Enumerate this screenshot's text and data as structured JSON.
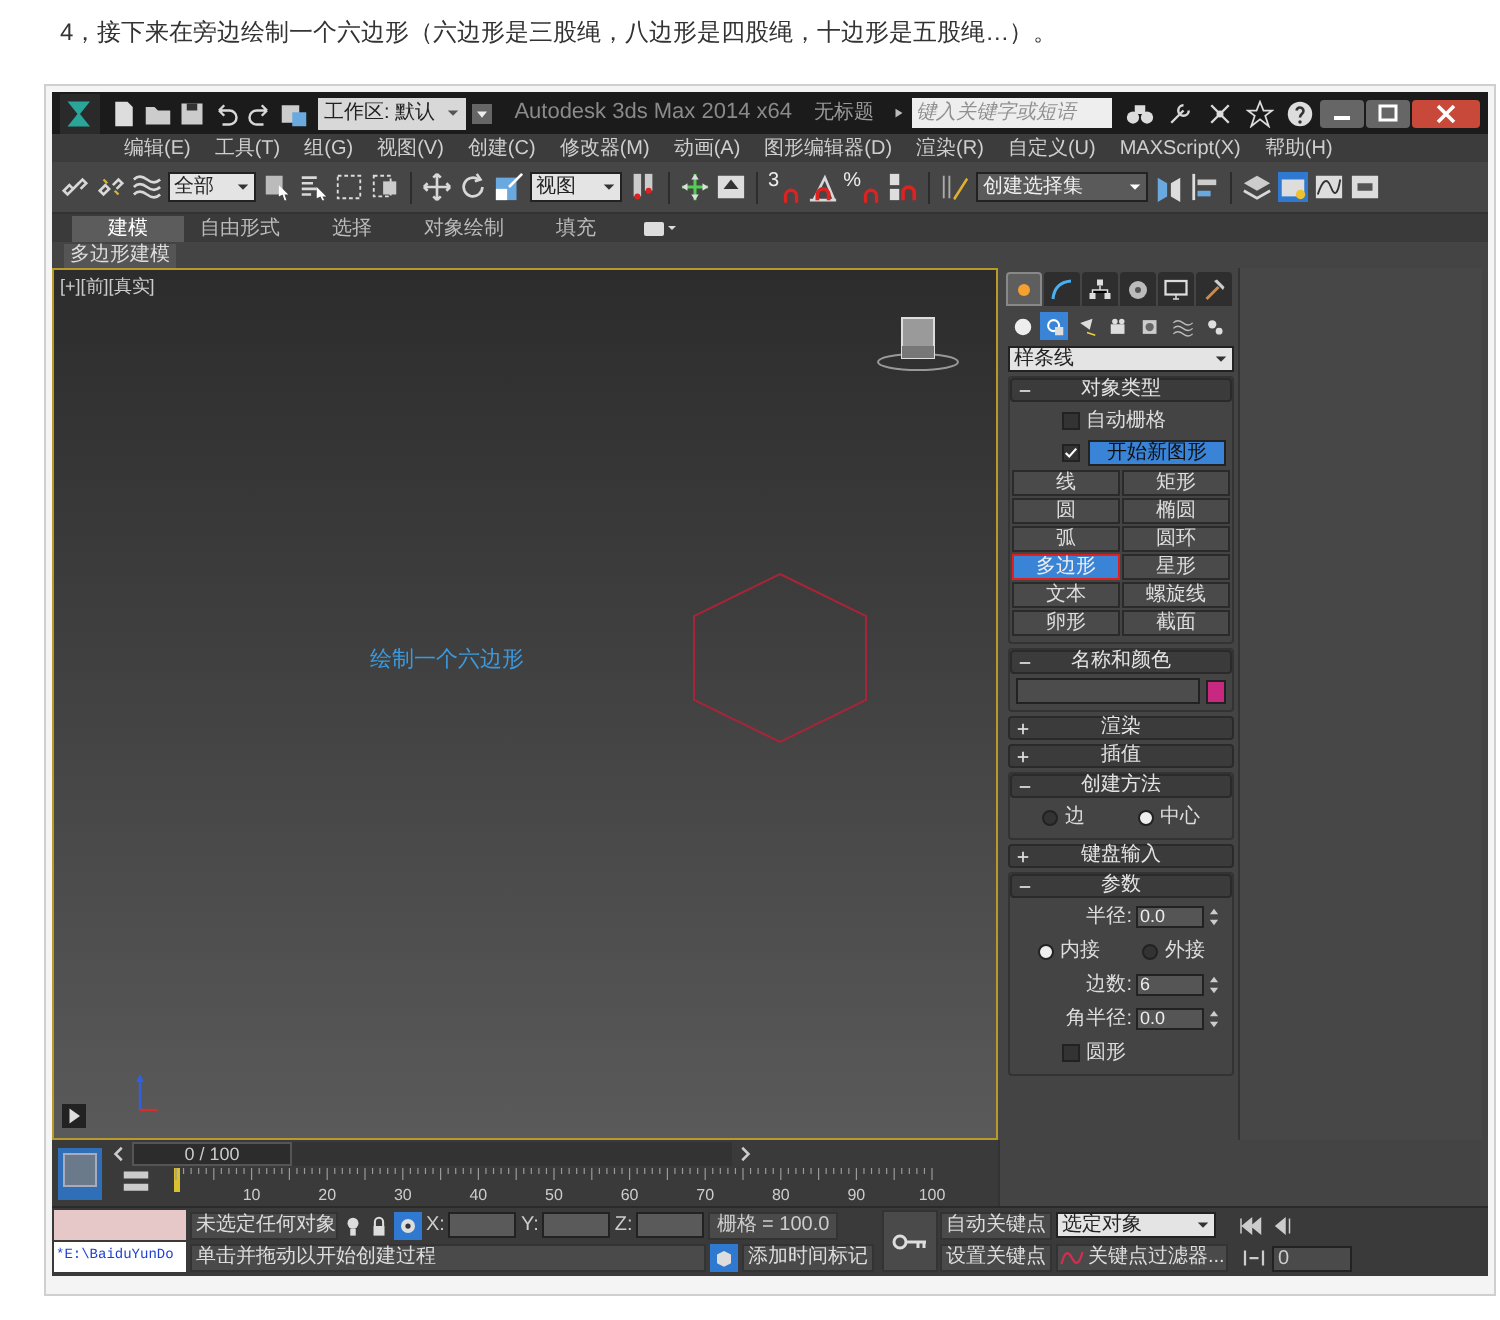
{
  "caption": "4，接下来在旁边绘制一个六边形（六边形是三股绳，八边形是四股绳，十边形是五股绳…）。",
  "title_bar": {
    "workspace": "工作区: 默认",
    "title": "Autodesk 3ds Max 2014 x64",
    "document": "无标题",
    "search_placeholder": "键入关键字或短语"
  },
  "menu": [
    "编辑(E)",
    "工具(T)",
    "组(G)",
    "视图(V)",
    "创建(C)",
    "修改器(M)",
    "动画(A)",
    "图形编辑器(D)",
    "渲染(R)",
    "自定义(U)",
    "MAXScript(X)",
    "帮助(H)"
  ],
  "toolbar": {
    "selection_filter": "全部",
    "reference_coord": "视图",
    "snap_glyphs": [
      "3",
      "%"
    ],
    "named_selection": "创建选择集"
  },
  "ribbon_tabs": [
    {
      "label": "建模",
      "selected": true
    },
    {
      "label": "自由形式",
      "selected": false
    },
    {
      "label": "选择",
      "selected": false
    },
    {
      "label": "对象绘制",
      "selected": false
    },
    {
      "label": "填充",
      "selected": false
    }
  ],
  "ribbon_panel": "多边形建模",
  "viewport": {
    "label": "[+][前][真实]",
    "annotation": "绘制一个六边形"
  },
  "command_panel": {
    "tabs": [
      {
        "selected": true
      },
      {
        "selected": false
      },
      {
        "selected": false
      },
      {
        "selected": false
      },
      {
        "selected": false
      },
      {
        "selected": false
      }
    ],
    "categories": [
      {
        "selected": false
      },
      {
        "selected": true
      },
      {
        "selected": false
      },
      {
        "selected": false
      },
      {
        "selected": false
      },
      {
        "selected": false
      },
      {
        "selected": false
      }
    ],
    "category": "样条线",
    "rollouts": [
      {
        "title": "对象类型",
        "expanded": true,
        "items": [
          {
            "kind": "checkbox",
            "label": "自动栅格",
            "checked": false
          },
          {
            "kind": "check_button",
            "label": "开始新图形",
            "checked": true,
            "active": true
          },
          {
            "kind": "button_grid",
            "buttons": [
              {
                "label": "线",
                "selected": false,
                "outlined": false
              },
              {
                "label": "矩形",
                "selected": false,
                "outlined": false
              },
              {
                "label": "圆",
                "selected": false,
                "outlined": false
              },
              {
                "label": "椭圆",
                "selected": false,
                "outlined": false
              },
              {
                "label": "弧",
                "selected": false,
                "outlined": false
              },
              {
                "label": "圆环",
                "selected": false,
                "outlined": false
              },
              {
                "label": "多边形",
                "selected": true,
                "outlined": true
              },
              {
                "label": "星形",
                "selected": false,
                "outlined": false
              },
              {
                "label": "文本",
                "selected": false,
                "outlined": false
              },
              {
                "label": "螺旋线",
                "selected": false,
                "outlined": false
              },
              {
                "label": "卵形",
                "selected": false,
                "outlined": false
              },
              {
                "label": "截面",
                "selected": false,
                "outlined": false
              }
            ]
          }
        ]
      },
      {
        "title": "名称和颜色",
        "expanded": true,
        "items": [
          {
            "kind": "name_color",
            "color": "#c8287f"
          }
        ]
      },
      {
        "title": "渲染",
        "expanded": false
      },
      {
        "title": "插值",
        "expanded": false
      },
      {
        "title": "创建方法",
        "expanded": true,
        "items": [
          {
            "kind": "radio",
            "options": [
              {
                "label": "边",
                "selected": false
              },
              {
                "label": "中心",
                "selected": true
              }
            ]
          }
        ]
      },
      {
        "title": "键盘输入",
        "expanded": false
      },
      {
        "title": "参数",
        "expanded": true,
        "items": [
          {
            "kind": "spinner",
            "label": "半径:",
            "value": "0.0"
          },
          {
            "kind": "radio",
            "options": [
              {
                "label": "内接",
                "selected": true
              },
              {
                "label": "外接",
                "selected": false
              }
            ]
          },
          {
            "kind": "spinner",
            "label": "边数:",
            "value": "6"
          },
          {
            "kind": "spinner",
            "label": "角半径:",
            "value": "0.0"
          },
          {
            "kind": "checkbox",
            "label": "圆形",
            "checked": false
          }
        ]
      }
    ]
  },
  "timeline": {
    "frame": "0 / 100",
    "level": 0,
    "ticks": [
      "10",
      "20",
      "30",
      "40",
      "50",
      "60",
      "70",
      "80",
      "90",
      "100"
    ]
  },
  "status": {
    "listener": "*E:\\BaiduYunDo",
    "selection": "未选定任何对象",
    "axes": [
      "X:",
      "Y:",
      "Z:"
    ],
    "grid": "栅格 = 100.0",
    "prompt": "单击并拖动以开始创建过程",
    "add_time_tag": "添加时间标记",
    "auto_key": "自动关键点",
    "key_mode": "选定对象",
    "set_key": "设置关键点",
    "key_filters": "关键点过滤器...",
    "current_frame": "0"
  }
}
